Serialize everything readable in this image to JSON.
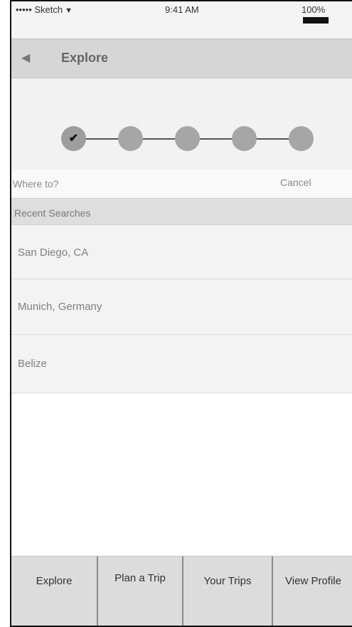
{
  "status_bar": {
    "carrier": "••••• Sketch",
    "time": "9:41 AM",
    "battery": "100%"
  },
  "nav": {
    "title": "Explore"
  },
  "stepper": {
    "steps_total": 5,
    "steps_completed": 1
  },
  "search": {
    "placeholder": "Where to?",
    "cancel_label": "Cancel"
  },
  "recent": {
    "header": "Recent Searches",
    "items": [
      "San Diego, CA",
      "Munich, Germany",
      "Belize"
    ]
  },
  "tabs": [
    "Explore",
    "Plan a Trip",
    "Your Trips",
    "View Profile"
  ]
}
